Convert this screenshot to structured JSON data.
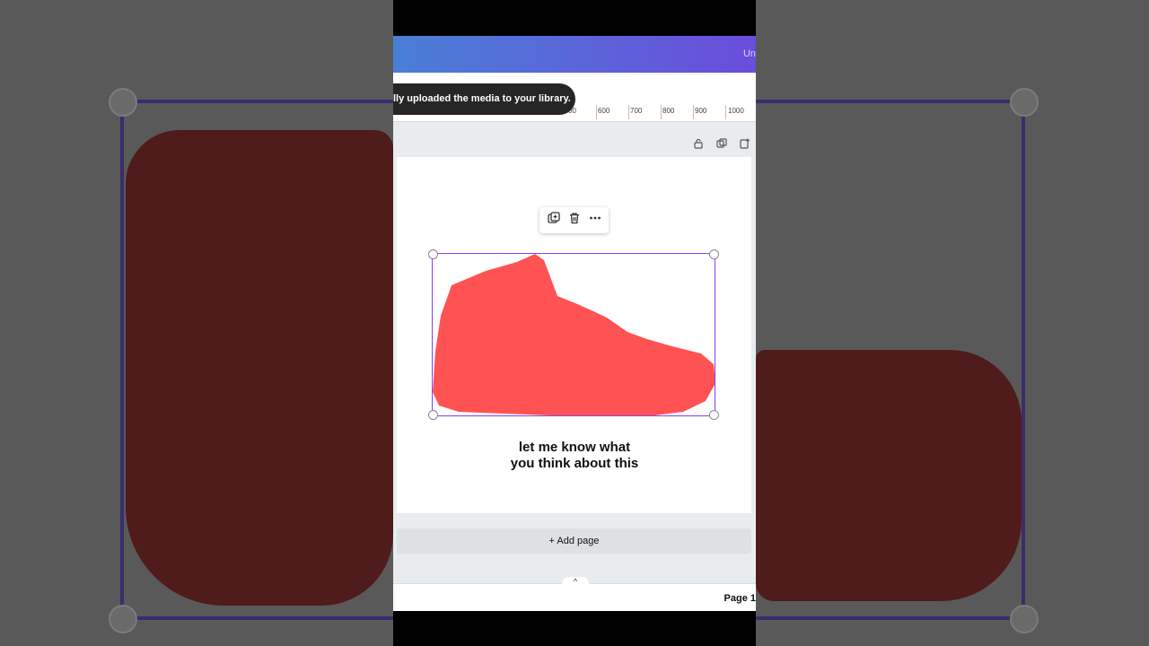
{
  "topbar": {
    "right_text": "Un"
  },
  "toast": {
    "message": "lly uploaded the media to your library."
  },
  "ruler": {
    "ticks": [
      "00",
      "600",
      "700",
      "800",
      "900",
      "1000"
    ]
  },
  "workspace": {
    "icons": [
      "lock-icon",
      "duplicate-page-icon",
      "add-page-icon"
    ]
  },
  "context_toolbar": {
    "icons": [
      "duplicate-icon",
      "trash-icon",
      "more-icon"
    ]
  },
  "canvas": {
    "caption_line1": "let me know what",
    "caption_line2": "you think about this",
    "shoe_color": "#ff5252"
  },
  "add_page": {
    "label": "+ Add page"
  },
  "bottombar": {
    "page_label": "Page 1"
  },
  "colors": {
    "selection": "#8b3dff",
    "header_start": "#4a7fd6",
    "header_end": "#6a4ddc"
  }
}
